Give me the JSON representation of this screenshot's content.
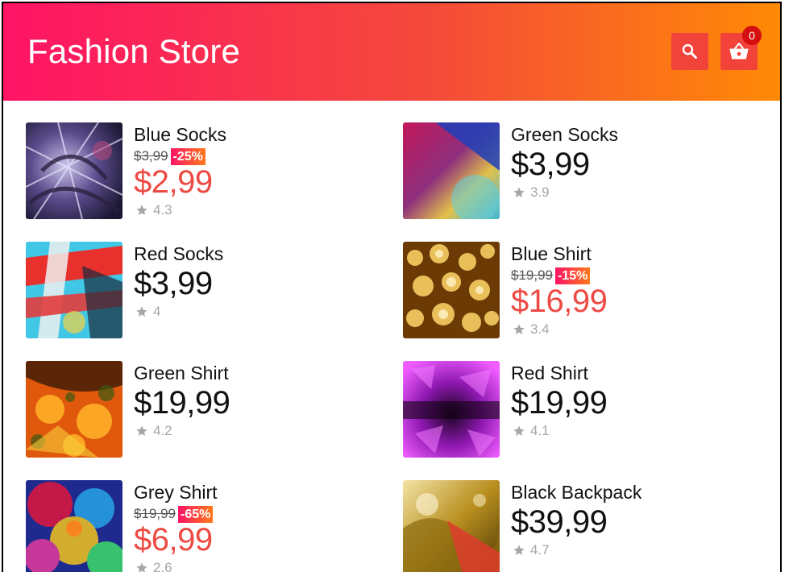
{
  "app": {
    "title": "Fashion Store",
    "cart_count": "0"
  },
  "products": [
    {
      "name": "Blue Socks",
      "old_price": "$3,99",
      "discount": "-25%",
      "price": "$2,99",
      "rating": "4.3",
      "on_sale": true,
      "thumb_icon": "abstract-purple-thumbnail"
    },
    {
      "name": "Green Socks",
      "old_price": "",
      "discount": "",
      "price": "$3,99",
      "rating": "3.9",
      "on_sale": false,
      "thumb_icon": "gradient-blur-thumbnail"
    },
    {
      "name": "Red Socks",
      "old_price": "",
      "discount": "",
      "price": "$3,99",
      "rating": "4",
      "on_sale": false,
      "thumb_icon": "paint-strokes-thumbnail"
    },
    {
      "name": "Blue Shirt",
      "old_price": "$19,99",
      "discount": "-15%",
      "price": "$16,99",
      "rating": "3.4",
      "on_sale": true,
      "thumb_icon": "gold-bokeh-thumbnail"
    },
    {
      "name": "Green Shirt",
      "old_price": "",
      "discount": "",
      "price": "$19,99",
      "rating": "4.2",
      "on_sale": false,
      "thumb_icon": "orange-splatter-thumbnail"
    },
    {
      "name": "Red Shirt",
      "old_price": "",
      "discount": "",
      "price": "$19,99",
      "rating": "4.1",
      "on_sale": false,
      "thumb_icon": "purple-crystal-thumbnail"
    },
    {
      "name": "Grey Shirt",
      "old_price": "$19,99",
      "discount": "-65%",
      "price": "$6,99",
      "rating": "2.6",
      "on_sale": true,
      "thumb_icon": "rainbow-crystal-thumbnail"
    },
    {
      "name": "Black Backpack",
      "old_price": "",
      "discount": "",
      "price": "$39,99",
      "rating": "4.7",
      "on_sale": false,
      "thumb_icon": "liquid-gold-thumbnail"
    }
  ],
  "colors": {
    "header_gradient": [
      "#ff1366",
      "#f44a3a",
      "#ff8a05"
    ],
    "sale_price": "#ee4a44",
    "badge": "#d50f0f",
    "rating": "#a6a6a6"
  }
}
